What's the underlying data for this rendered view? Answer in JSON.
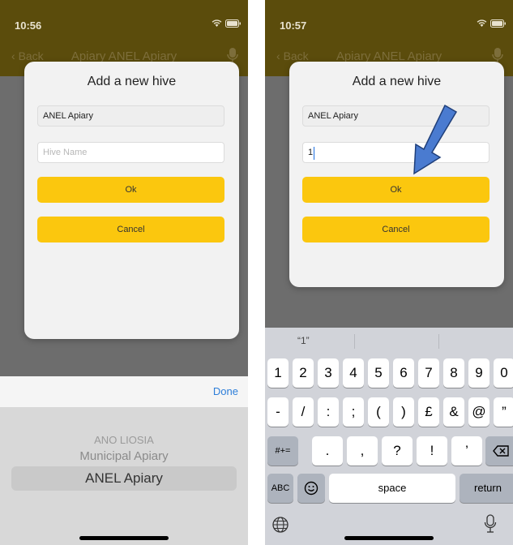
{
  "left": {
    "status_time": "10:56",
    "nav_back": "Back",
    "nav_title": "Apiary ANEL Apiary",
    "dialog_title": "Add a new hive",
    "apiary_value": "ANEL Apiary",
    "hive_placeholder": "Hive Name",
    "ok_label": "Ok",
    "cancel_label": "Cancel",
    "done_label": "Done",
    "picker_options": [
      "ANO LIOSIA",
      "Municipal Apiary",
      "ANEL Apiary"
    ]
  },
  "right": {
    "status_time": "10:57",
    "nav_back": "Back",
    "nav_title": "Apiary ANEL Apiary",
    "dialog_title": "Add a new hive",
    "apiary_value": "ANEL Apiary",
    "hive_value": "1",
    "ok_label": "Ok",
    "cancel_label": "Cancel",
    "suggestion": "“1”",
    "keyboard": {
      "row1": [
        "1",
        "2",
        "3",
        "4",
        "5",
        "6",
        "7",
        "8",
        "9",
        "0"
      ],
      "row2": [
        "-",
        "/",
        ":",
        ";",
        "(",
        ")",
        "£",
        "&",
        "@",
        "”"
      ],
      "row3": [
        ".",
        ",",
        "?",
        "!",
        "’"
      ],
      "symbols_key": "#+=",
      "abc_key": "ABC",
      "space_key": "space",
      "return_key": "return"
    }
  },
  "colors": {
    "accent_yellow": "#fbc70e",
    "nav_dark": "#5b4c0c",
    "done_blue": "#2d7ed9",
    "arrow_blue": "#4a7bd0"
  },
  "icons": [
    "wifi-icon",
    "battery-icon",
    "microphone-icon",
    "chevron-left-icon",
    "globe-icon",
    "emoji-icon",
    "backspace-icon",
    "dictation-icon",
    "arrow-annotation-icon"
  ]
}
